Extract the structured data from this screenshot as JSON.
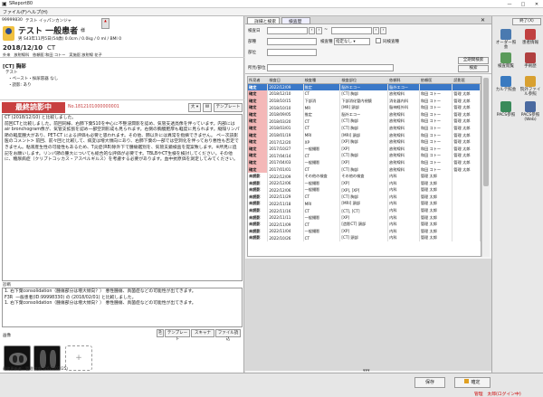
{
  "app": {
    "title": "SReport80",
    "menu": [
      "ファイル(F)",
      "ヘルプ(H)"
    ],
    "logout": "終了(X)"
  },
  "patient": {
    "id": "99999830",
    "kana": "テスト イッパンカンジャ",
    "name": "テスト 一般患者",
    "honorific": "様",
    "info": "男 S43年11月5日(54歳)  0.0cm / 0.0kg / 0 ml / BMI 0",
    "exam_date": "2018/12/10",
    "modality": "CT",
    "exam_meta": [
      "外来",
      "放射線科",
      "依頼医:和田 コトー",
      "実施医:放射線 花子"
    ]
  },
  "order": {
    "title": "[CT] 胸部",
    "lines": [
      "テスト",
      "・ペースト・採尿容器 なし",
      "・読影: あり"
    ]
  },
  "report": {
    "status": "最終読影中",
    "number": "No.1812101000000001",
    "template_btn": "テンプレート",
    "findings": "CT (2018/12/10) と比較しました。\n前回CTと比較しました。前回同様、右肺下葉S10を中心に不整浸潤影を認め、気管支透亮像を伴っています。内部にはair bronchogram像が、気管支拡張を認め一部空洞形成も見られます。右側の胸膜肥厚も軽度に見られます。縦隔リンパ節の軽度腫大があり、PET-CT による評価も必要と思われます。その他、肺以外には異常を指摘できません。 ペー次読影医のコメント> 前回、前々回と比較して、病変は増大傾向にあり、右肺下葉の一部では空洞化を伴っており悪性も否定できません。粘液産生性の可能性もあるため、T炎症(RB)除外下で腫瘍鑑別を、気管支鏡検査を提案致します。※所見に追記をお願いします。リンパ節の腫大についても総合的な評価が必要です。TBLBやCT生検を検討してください。その他に、糖尿病症（クリプトコッカス・アスペルギルス）を考慮する必要があります。血中抗原価を測定してみてください。",
    "impression_label": "診断",
    "impression": "1. 右下葉consolidation（腫瘍部分は増大傾向？） 悪性腫瘍、真菌症などの可能性が出てきます。\nF3R  一般患者(ID:99998330) の (2018/02/01) と比較しました。\n1. 右下葉consolidation（腫瘍部分は増大傾向？） 悪性腫瘍、真菌症などの可能性が出てきます。",
    "images_label": "画像",
    "image_btns": [
      "テンプレート",
      "スキャナ",
      "ファイル読込"
    ],
    "updated": "最終更新者：管理 太郎 (2021/02/25)"
  },
  "history": {
    "tabs": [
      "詳細と検索",
      "検査歴"
    ],
    "search": {
      "date_label": "検査日",
      "modality_label": "部種",
      "type_label": "検査種",
      "type_value": "指定なし",
      "part_label": "部位",
      "same_label": "同検査種",
      "all_btn": "全期間検索",
      "search_btn": "検索",
      "dept_label": "所見/部位"
    },
    "columns": [
      "所見者",
      "検査日",
      "検査種",
      "検査部位",
      "依頼科",
      "依頼医",
      "読影医"
    ],
    "rows": [
      [
        "確定",
        "2022/12/09",
        "推定",
        "脳外エコー",
        "脳外エコー",
        "",
        ""
      ],
      [
        "確定",
        "2018/12/10",
        "CT",
        "[CT] 胸部",
        "放射線科",
        "和田 コトー",
        "管理 太郎"
      ],
      [
        "確定",
        "2018/10/15",
        "下部消",
        "下部消化管内視鏡",
        "消化器内科",
        "和田 コトー",
        "管理 太郎"
      ],
      [
        "確定",
        "2018/10/10",
        "MR",
        "[MR] 頭部",
        "脳神経外科",
        "和田 コトー",
        "管理 太郎"
      ],
      [
        "確定",
        "2018/09/05",
        "推定",
        "脳外エコー",
        "放射線科",
        "和田 コトー",
        "管理 太郎"
      ],
      [
        "確定",
        "2018/03/20",
        "CT",
        "[CT] 胸部",
        "放射線科",
        "和田 コトー",
        "管理 太郎"
      ],
      [
        "確定",
        "2018/03/01",
        "CT",
        "[CT] 胸部",
        "放射線科",
        "和田 コトー",
        "管理 太郎"
      ],
      [
        "確定",
        "2018/01/19",
        "MRI",
        "[MRI] 頭部",
        "放射線科",
        "和田 コトー",
        "管理 太郎"
      ],
      [
        "確定",
        "2017/12/20",
        "XP",
        "[XP] 胸部",
        "放射線科",
        "和田 コトー",
        "管理 太郎"
      ],
      [
        "確定",
        "2017/10/27",
        "一般撮影",
        "[XP]",
        "放射線科",
        "和田 コトー",
        "管理 太郎"
      ],
      [
        "確定",
        "2017/04/14",
        "CT",
        "[CT] 胸部",
        "放射線科",
        "和田 コトー",
        "管理 太郎"
      ],
      [
        "確定",
        "2017/04/03",
        "一般撮影",
        "[XP]",
        "放射線科",
        "和田 コトー",
        "管理 太郎"
      ],
      [
        "確定",
        "2017/01/01",
        "CT",
        "[CT] 胸部",
        "放射線科",
        "和田 コトー",
        "管理 太郎"
      ],
      [
        "未読影",
        "2022/12/09",
        "その他の検査",
        "その他の検査",
        "内科",
        "管理 太郎",
        ""
      ],
      [
        "未読影",
        "2022/12/06",
        "一般撮影",
        "[XP]",
        "内科",
        "管理 太郎",
        ""
      ],
      [
        "未読影",
        "2022/12/06",
        "一般撮影",
        "[XP], [XP]",
        "内科",
        "管理 太郎",
        ""
      ],
      [
        "未読影",
        "2022/11/29",
        "CT",
        "[CT] 胸部",
        "内科",
        "管理 太郎",
        ""
      ],
      [
        "未読影",
        "2022/11/18",
        "MRI",
        "[MRI] 頭部",
        "内科",
        "管理 太郎",
        ""
      ],
      [
        "未読影",
        "2022/11/16",
        "CT",
        "[CT], [CT]",
        "内科",
        "管理 太郎",
        ""
      ],
      [
        "未読影",
        "2022/11/11",
        "一般撮影",
        "[XP]",
        "内科",
        "管理 太郎",
        ""
      ],
      [
        "未読影",
        "2022/11/09",
        "CT",
        "[造影CT] 頭部",
        "内科",
        "管理 太郎",
        ""
      ],
      [
        "未読影",
        "2022/11/04",
        "一般撮影",
        "[XP]",
        "内科",
        "管理 太郎",
        ""
      ],
      [
        "未読影",
        "2022/10/26",
        "CT",
        "[CT] 頭部",
        "内科",
        "管理 太郎",
        ""
      ]
    ]
  },
  "toolbar": {
    "items": [
      "オーダー照会",
      "患者情報",
      "検査閲覧",
      "手術歴",
      "カルテ照会",
      "院外ファイル参照",
      "PACS参照",
      "PACS参照(Web)"
    ]
  },
  "footer": {
    "save": "保存",
    "confirm": "確定",
    "user": "管理　太郎(ログイン中)"
  }
}
